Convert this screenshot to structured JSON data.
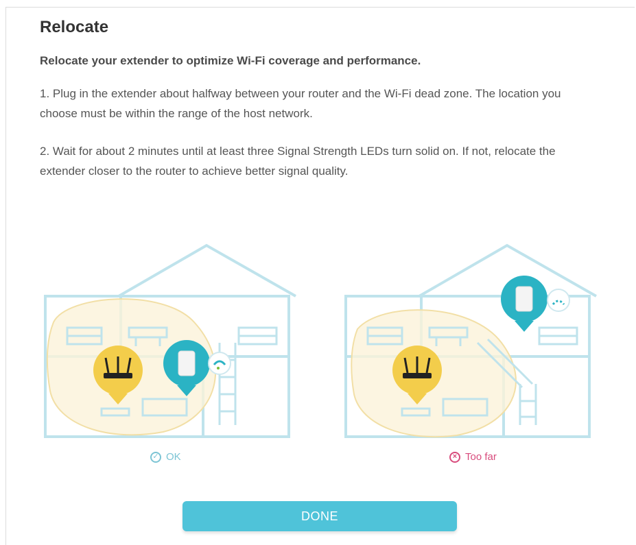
{
  "dialog": {
    "title": "Relocate",
    "subtitle": "Relocate your extender to optimize Wi-Fi coverage and performance.",
    "steps": [
      "1. Plug in the extender about halfway between your router and the Wi-Fi dead zone. The location you choose must be within the range of the host network.",
      "2. Wait for about 2 minutes until at least three Signal Strength LEDs turn solid on. If not, relocate the extender closer to the router to achieve better signal quality."
    ]
  },
  "illustrations": [
    {
      "status_label": "OK",
      "status_icon": "check-circle-icon",
      "status_color": "#7cc4d4"
    },
    {
      "status_label": "Too far",
      "status_icon": "x-circle-icon",
      "status_color": "#d84b7c"
    }
  ],
  "colors": {
    "accent": "#4fc3d9",
    "house_outline": "#bfe3ec",
    "coverage": "#fbf3d9",
    "router_bg": "#f3cd4b",
    "extender_bg": "#2bb3c4"
  },
  "actions": {
    "done_label": "DONE"
  }
}
